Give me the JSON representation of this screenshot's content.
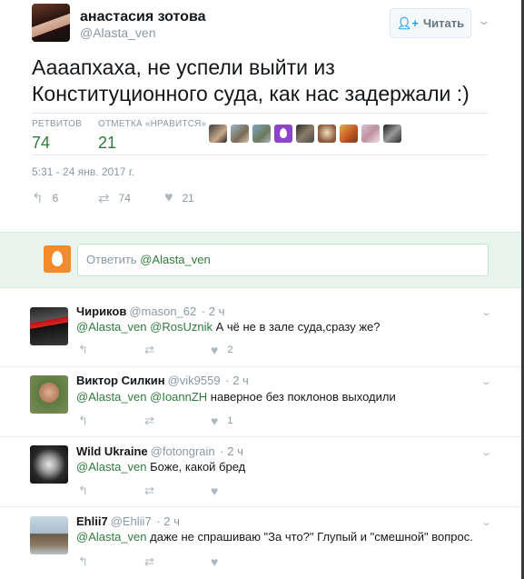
{
  "tweet": {
    "author_name": "анастасия зотова",
    "author_handle": "@Alasta_ven",
    "follow_label": "Читать",
    "text": "Аааапхаха, не успели выйти из Конституционного суда, как нас задержали :)",
    "retweets_label": "РЕТВИТОВ",
    "retweets": "74",
    "likes_label": "ОТМЕТКА «НРАВИТСЯ»",
    "likes": "21",
    "timestamp": "5:31 - 24 янв. 2017 г.",
    "action_reply_count": "6",
    "action_retweet_count": "74",
    "action_like_count": "21"
  },
  "reply_box": {
    "placeholder_prefix": "Ответить",
    "placeholder_mention": "@Alasta_ven"
  },
  "replies": [
    {
      "name": "Чириков",
      "handle": "@mason_62",
      "time": "· 2 ч",
      "mentions": "@Alasta_ven @RosUznik",
      "text": " А чё не в зале суда,сразу же?",
      "like_count": "2"
    },
    {
      "name": "Виктор Силкин",
      "handle": "@vik9559",
      "time": "· 2 ч",
      "mentions": "@Alasta_ven @IoannZH",
      "text": " наверное без поклонов выходили",
      "like_count": "1"
    },
    {
      "name": "Wild Ukraine",
      "handle": "@fotongrain",
      "time": "· 2 ч",
      "mentions": "@Alasta_ven",
      "text": " Боже, какой бред",
      "like_count": ""
    },
    {
      "name": "Ehlii7",
      "handle": "@Ehlii7",
      "time": "· 2 ч",
      "mentions": "@Alasta_ven",
      "text": " даже не спрашиваю \"За что?\" Глупый и \"смешной\" вопрос.",
      "like_count": ""
    }
  ],
  "icons": {
    "reply": "reply-icon",
    "retweet": "retweet-icon",
    "like": "heart-icon",
    "caret": "chevron-down-icon",
    "follow": "add-user-icon"
  },
  "colors": {
    "accent_green": "#2f7a3d",
    "reply_box_bg": "#e8f5ee",
    "egg_avatar": "#f58a2b"
  }
}
